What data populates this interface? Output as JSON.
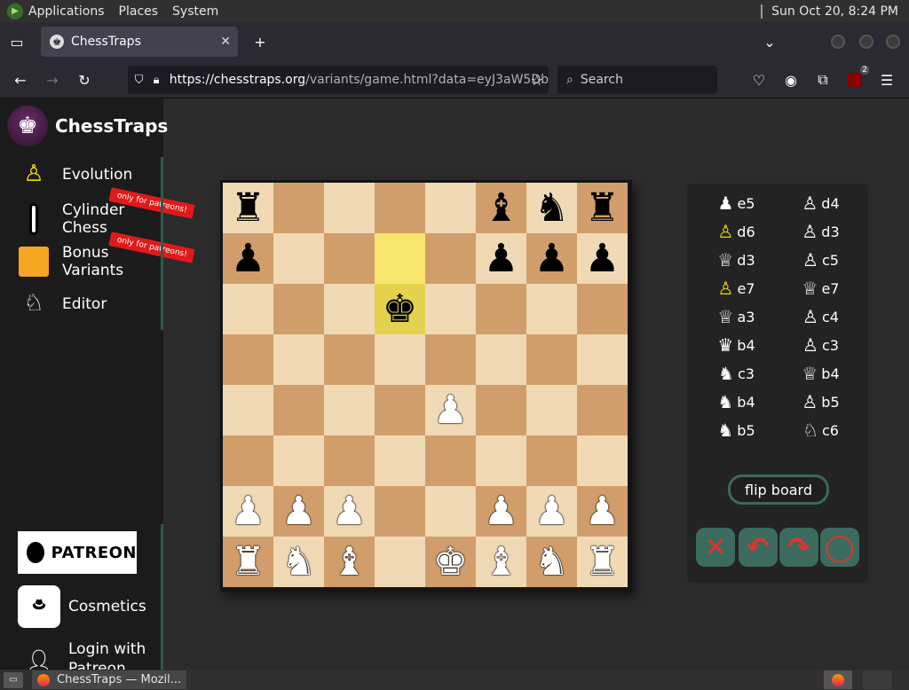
{
  "top_panel": {
    "menus": [
      "Applications",
      "Places",
      "System"
    ],
    "clock": "Sun Oct 20,  8:24 PM"
  },
  "browser": {
    "tab_title": "ChessTraps",
    "new_tab_icon": "plus-icon",
    "url_host": "https://chesstraps.org",
    "url_path": "/variants/game.html?data=eyJ3aW5Db",
    "search_placeholder": "Search",
    "extension_badge": "2"
  },
  "sidebar": {
    "brand": "ChessTraps",
    "items": [
      {
        "label": "Evolution",
        "icon": "fire-pawn-icon"
      },
      {
        "label": "Cylinder Chess",
        "icon": "cylinder-icon",
        "ribbon": "only for patreons!"
      },
      {
        "label": "Bonus Variants",
        "icon": "bonus-icon",
        "ribbon": "only for patreons!"
      },
      {
        "label": "Editor",
        "icon": "editor-icon"
      }
    ],
    "patreon_label": "PATREON",
    "cosmetics_label": "Cosmetics",
    "login_label": "Login with Patreon"
  },
  "board": {
    "light_color": "#f0d9b5",
    "dark_color": "#d19e6b",
    "highlight_color": "#f6e76c",
    "rows": [
      [
        "bR",
        "",
        "",
        "",
        "",
        "bB",
        "bN",
        "bR"
      ],
      [
        "bP",
        "",
        "",
        "",
        "",
        "bP",
        "bP",
        "bP"
      ],
      [
        "",
        "",
        "",
        "bK",
        "",
        "",
        "",
        ""
      ],
      [
        "",
        "",
        "",
        "",
        "",
        "",
        "",
        ""
      ],
      [
        "",
        "",
        "",
        "",
        "wP",
        "",
        "",
        ""
      ],
      [
        "",
        "",
        "",
        "",
        "",
        "",
        "",
        ""
      ],
      [
        "wP",
        "wP",
        "wP",
        "",
        "",
        "wP",
        "wP",
        "wP"
      ],
      [
        "wR",
        "wN",
        "wB",
        "",
        "wK",
        "wB",
        "wN",
        "wR"
      ]
    ],
    "highlighted": [
      "b6",
      "b7"
    ]
  },
  "moves": [
    [
      "e5",
      "d4"
    ],
    [
      "d6",
      "d3"
    ],
    [
      "d3",
      "c5"
    ],
    [
      "e7",
      "e7"
    ],
    [
      "a3",
      "c4"
    ],
    [
      "b4",
      "c3"
    ],
    [
      "c3",
      "b4"
    ],
    [
      "b4",
      "b5"
    ],
    [
      "b5",
      "c6"
    ]
  ],
  "controls": {
    "flip_label": "flip board",
    "buttons": [
      "resign",
      "undo",
      "redo",
      "restart"
    ]
  },
  "taskbar": {
    "task_label": "ChessTraps — Mozil..."
  }
}
